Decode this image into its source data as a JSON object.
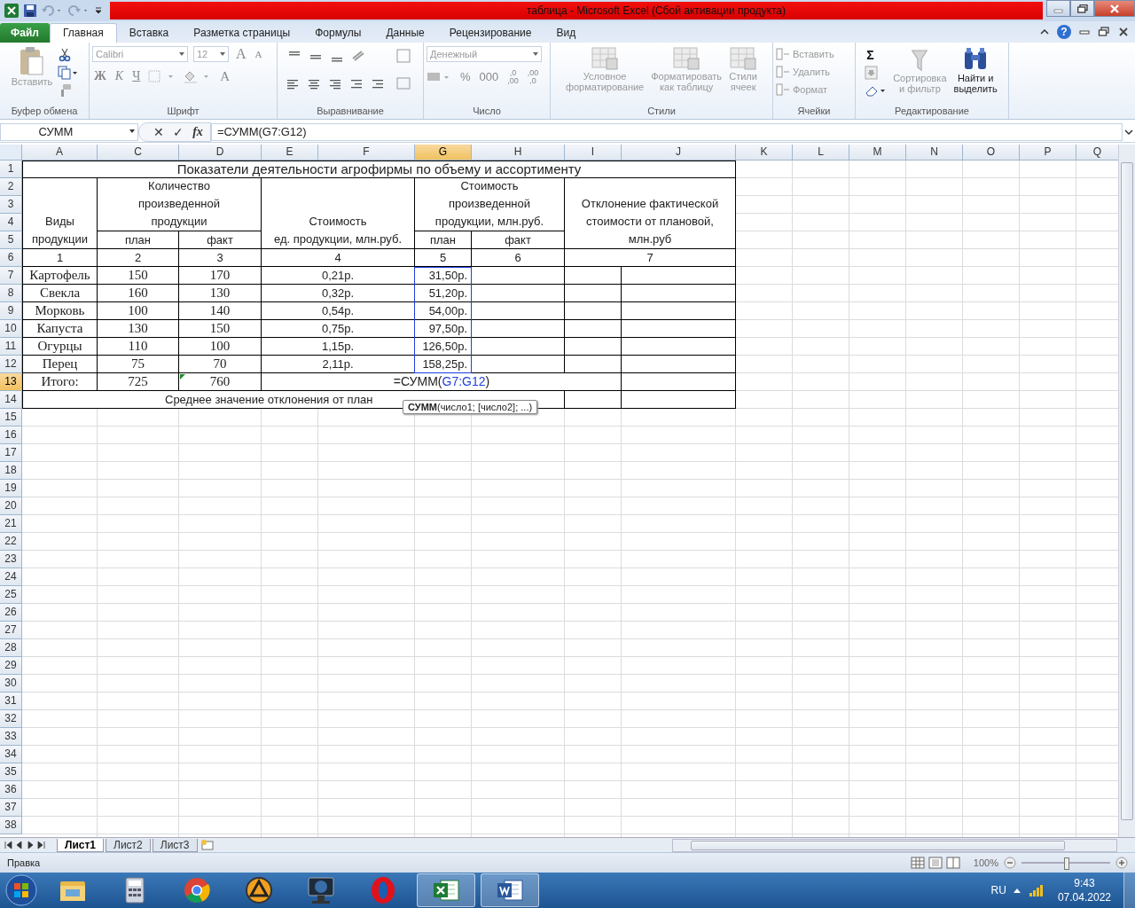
{
  "window": {
    "title": "таблица  -  Microsoft Excel (Сбой активации продукта)"
  },
  "tabs": [
    {
      "label": "Файл",
      "kind": "file",
      "selected": false
    },
    {
      "label": "Главная",
      "kind": "tab",
      "selected": true
    },
    {
      "label": "Вставка",
      "kind": "tab",
      "selected": false
    },
    {
      "label": "Разметка страницы",
      "kind": "tab",
      "selected": false
    },
    {
      "label": "Формулы",
      "kind": "tab",
      "selected": false
    },
    {
      "label": "Данные",
      "kind": "tab",
      "selected": false
    },
    {
      "label": "Рецензирование",
      "kind": "tab",
      "selected": false
    },
    {
      "label": "Вид",
      "kind": "tab",
      "selected": false
    }
  ],
  "help": "?",
  "ribbon": {
    "groups": [
      {
        "kind": "clipboard",
        "label": "Буфер обмена",
        "paste": {
          "label": "Вставить",
          "disabled": true
        }
      },
      {
        "kind": "font",
        "label": "Шрифт",
        "font": "Calibri",
        "size": "12",
        "grow": "A",
        "shrink": "A",
        "bold": "Ж",
        "italic": "К",
        "underline": "Ч",
        "font_color_button": "A"
      },
      {
        "kind": "align",
        "label": "Выравнивание"
      },
      {
        "kind": "number",
        "label": "Число",
        "format": "Денежный",
        "percent": "%",
        "thousands": "000",
        "more_decimals": ",0\n,00",
        "less_decimals": ",00\n,0"
      },
      {
        "kind": "styles",
        "label": "Стили",
        "buttons": [
          {
            "label": "Условное\nформатирование",
            "disabled": true
          },
          {
            "label": "Форматировать\nкак таблицу",
            "disabled": true
          },
          {
            "label": "Стили\nячеек",
            "disabled": true
          }
        ]
      },
      {
        "kind": "cells",
        "label": "Ячейки",
        "buttons": [
          {
            "label": "Вставить",
            "disabled": true
          },
          {
            "label": "Удалить",
            "disabled": true
          },
          {
            "label": "Формат",
            "disabled": true
          }
        ]
      },
      {
        "kind": "editing",
        "label": "Редактирование",
        "sum": "Σ",
        "buttons": [
          {
            "label": "Сортировка\nи фильтр",
            "disabled": true
          },
          {
            "label": "Найти и\nвыделить",
            "disabled": false
          }
        ]
      }
    ]
  },
  "formula_bar": {
    "name_box": "СУММ",
    "cancel": "✕",
    "enter": "✓",
    "fx": "fx",
    "formula": "=СУММ(G7:G12)"
  },
  "sheet": {
    "columns": [
      {
        "label": "A",
        "selected": false
      },
      {
        "label": "C",
        "selected": false
      },
      {
        "label": "D",
        "selected": false
      },
      {
        "label": "E",
        "selected": false
      },
      {
        "label": "F",
        "selected": false
      },
      {
        "label": "G",
        "selected": true
      },
      {
        "label": "H",
        "selected": false
      },
      {
        "label": "I",
        "selected": false
      },
      {
        "label": "J",
        "selected": false
      },
      {
        "label": "K",
        "selected": false
      },
      {
        "label": "L",
        "selected": false
      },
      {
        "label": "M",
        "selected": false
      },
      {
        "label": "N",
        "selected": false
      },
      {
        "label": "O",
        "selected": false
      },
      {
        "label": "P",
        "selected": false
      },
      {
        "label": "Q",
        "selected": false
      }
    ],
    "rows": [
      {
        "label": "1",
        "selected": false
      },
      {
        "label": "2",
        "selected": false
      },
      {
        "label": "3",
        "selected": false
      },
      {
        "label": "4",
        "selected": false
      },
      {
        "label": "5",
        "selected": false
      },
      {
        "label": "6",
        "selected": false
      },
      {
        "label": "7",
        "selected": false
      },
      {
        "label": "8",
        "selected": false
      },
      {
        "label": "9",
        "selected": false
      },
      {
        "label": "10",
        "selected": false
      },
      {
        "label": "11",
        "selected": false
      },
      {
        "label": "12",
        "selected": false
      },
      {
        "label": "13",
        "selected": true
      },
      {
        "label": "14",
        "selected": false
      },
      {
        "label": "15",
        "selected": false
      },
      {
        "label": "16",
        "selected": false
      },
      {
        "label": "17",
        "selected": false
      },
      {
        "label": "18",
        "selected": false
      },
      {
        "label": "19",
        "selected": false
      },
      {
        "label": "20",
        "selected": false
      },
      {
        "label": "21",
        "selected": false
      },
      {
        "label": "22",
        "selected": false
      },
      {
        "label": "23",
        "selected": false
      },
      {
        "label": "24",
        "selected": false
      },
      {
        "label": "25",
        "selected": false
      },
      {
        "label": "26",
        "selected": false
      },
      {
        "label": "27",
        "selected": false
      },
      {
        "label": "28",
        "selected": false
      },
      {
        "label": "29",
        "selected": false
      },
      {
        "label": "30",
        "selected": false
      },
      {
        "label": "31",
        "selected": false
      },
      {
        "label": "32",
        "selected": false
      },
      {
        "label": "33",
        "selected": false
      },
      {
        "label": "34",
        "selected": false
      },
      {
        "label": "35",
        "selected": false
      },
      {
        "label": "36",
        "selected": false
      },
      {
        "label": "37",
        "selected": false
      },
      {
        "label": "38",
        "selected": false
      }
    ]
  },
  "table": {
    "title": "Показатели деятельности агрофирмы по объему и ассортименту",
    "header": [
      {
        "lines": [
          "Виды",
          "продукции"
        ]
      },
      {
        "lines": [
          "Количество",
          "произведенной",
          "продукции"
        ]
      },
      {
        "lines": [
          "Стоимость",
          "ед. продукции, млн.руб."
        ]
      },
      {
        "lines": [
          "Стоимость",
          "произведенной",
          "продукции, млн.руб."
        ]
      },
      {
        "lines": [
          "Отклонение фактической",
          "стоимости от плановой,",
          "млн.руб"
        ]
      }
    ],
    "subheader": [
      "план",
      "факт",
      "план",
      "факт"
    ],
    "index_row": [
      "1",
      "2",
      "3",
      "4",
      "5",
      "6",
      "7"
    ],
    "rows": [
      {
        "name": "Картофель",
        "plan": "150",
        "fact": "170",
        "price": "0,21р.",
        "cost": "31,50р."
      },
      {
        "name": "Свекла",
        "plan": "160",
        "fact": "130",
        "price": "0,32р.",
        "cost": "51,20р."
      },
      {
        "name": "Морковь",
        "plan": "100",
        "fact": "140",
        "price": "0,54р.",
        "cost": "54,00р."
      },
      {
        "name": "Капуста",
        "plan": "130",
        "fact": "150",
        "price": "0,75р.",
        "cost": "97,50р."
      },
      {
        "name": "Огурцы",
        "plan": "110",
        "fact": "100",
        "price": "1,15р.",
        "cost": "126,50р."
      },
      {
        "name": "Перец",
        "plan": "75",
        "fact": "70",
        "price": "2,11р.",
        "cost": "158,25р."
      }
    ],
    "total": {
      "label": "Итого:",
      "plan": "725",
      "fact": "760"
    },
    "editor": {
      "before": "=СУММ(",
      "reference": "G7:G12",
      "after": ")"
    },
    "footer": "Среднее значение отклонения от план",
    "tooltip": {
      "function": "СУММ",
      "args": "(число1; [число2]; ...)"
    }
  },
  "sheet_tabs": [
    {
      "label": "Лист1",
      "selected": true
    },
    {
      "label": "Лист2",
      "selected": false
    },
    {
      "label": "Лист3",
      "selected": false
    }
  ],
  "status_bar": {
    "mode": "Правка",
    "zoom": "100%",
    "zoom_slider": {
      "level": 0.5
    }
  },
  "taskbar": {
    "language": "RU",
    "time": "9:43",
    "date": "07.04.2022"
  }
}
